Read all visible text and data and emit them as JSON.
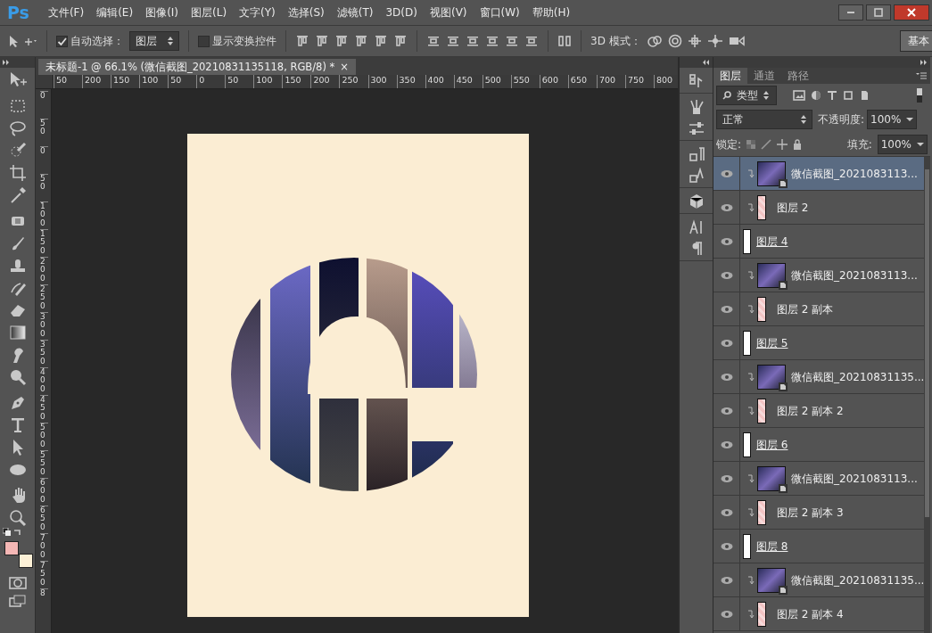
{
  "app": {
    "logo": "Ps"
  },
  "menu": [
    "文件(F)",
    "编辑(E)",
    "图像(I)",
    "图层(L)",
    "文字(Y)",
    "选择(S)",
    "滤镜(T)",
    "3D(D)",
    "视图(V)",
    "窗口(W)",
    "帮助(H)"
  ],
  "options_bar": {
    "auto_select": {
      "label": "自动选择：",
      "checked": true
    },
    "auto_select_target": "图层",
    "show_transform": {
      "label": "显示变换控件",
      "checked": false
    },
    "mode_label": "3D 模式：",
    "workspace_button": "基本"
  },
  "document_tab": {
    "title": "未标题-1 @ 66.1% (微信截图_20210831135118, RGB/8) *",
    "close": "×"
  },
  "ruler_h": [
    "50",
    "200",
    "150",
    "100",
    "50",
    "0",
    "50",
    "100",
    "150",
    "200",
    "250",
    "300",
    "350",
    "400",
    "450",
    "500",
    "550",
    "600",
    "650",
    "700",
    "750",
    "800"
  ],
  "ruler_v": [
    "0",
    "50",
    "0",
    "50",
    "100",
    "150",
    "200",
    "250",
    "300",
    "350",
    "400",
    "450",
    "500",
    "550",
    "600",
    "650",
    "700",
    "750",
    "8"
  ],
  "layers_panel": {
    "tabs": [
      {
        "label": "图层",
        "selected": true
      },
      {
        "label": "通道",
        "selected": false
      },
      {
        "label": "路径",
        "selected": false
      }
    ],
    "filter": "类型",
    "blend_mode": "正常",
    "opacity_label": "不透明度:",
    "opacity": "100%",
    "lock_label": "锁定:",
    "fill_label": "填充:",
    "fill": "100%",
    "layers": [
      {
        "kind": "photo",
        "name": "微信截图_2021083113...",
        "visible": true,
        "selected": true
      },
      {
        "kind": "mask",
        "name": "图层 2",
        "visible": true,
        "selected": false
      },
      {
        "kind": "shape",
        "name": "图层 4",
        "visible": true,
        "selected": false
      },
      {
        "kind": "photo",
        "name": "微信截图_2021083113...",
        "visible": true,
        "selected": false
      },
      {
        "kind": "mask",
        "name": "图层 2 副本",
        "visible": true,
        "selected": false
      },
      {
        "kind": "shape",
        "name": "图层 5",
        "visible": true,
        "selected": false
      },
      {
        "kind": "photo",
        "name": "微信截图_20210831135...",
        "visible": true,
        "selected": false
      },
      {
        "kind": "mask",
        "name": "图层 2 副本 2",
        "visible": true,
        "selected": false
      },
      {
        "kind": "shape",
        "name": "图层 6",
        "visible": true,
        "selected": false
      },
      {
        "kind": "photo",
        "name": "微信截图_2021083113...",
        "visible": true,
        "selected": false
      },
      {
        "kind": "mask",
        "name": "图层 2 副本 3",
        "visible": true,
        "selected": false
      },
      {
        "kind": "shape",
        "name": "图层 8",
        "visible": true,
        "selected": false
      },
      {
        "kind": "photo",
        "name": "微信截图_20210831135...",
        "visible": true,
        "selected": false
      },
      {
        "kind": "mask",
        "name": "图层 2 副本 4",
        "visible": true,
        "selected": false
      }
    ]
  }
}
